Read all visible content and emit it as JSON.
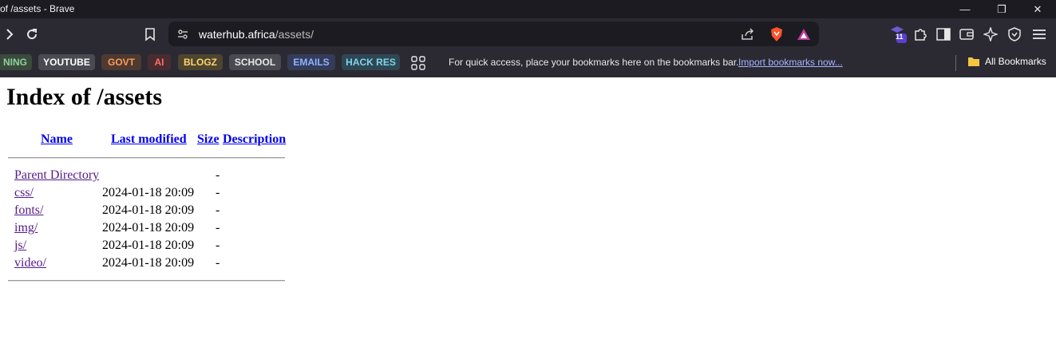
{
  "window": {
    "title": "of /assets - Brave",
    "controls": {
      "minimize": "—",
      "restore": "❐",
      "close": "✕"
    }
  },
  "toolbar": {
    "forward_icon": "chevron-right-icon",
    "reload_icon": "reload-icon",
    "bookmark_icon": "bookmark-icon",
    "url_host": "waterhub.africa",
    "url_path": "/assets/",
    "extension_badge": "11"
  },
  "bookmarks_bar": {
    "items": [
      {
        "label": "NING",
        "bg": "#3a4a3c",
        "fg": "#8fd19e"
      },
      {
        "label": "YOUTUBE",
        "bg": "#4a4a52",
        "fg": "#ffffff"
      },
      {
        "label": "GOVT",
        "bg": "#4d3a30",
        "fg": "#ff9b5c"
      },
      {
        "label": "AI",
        "bg": "#4a2c30",
        "fg": "#ff6b6b"
      },
      {
        "label": "BLOGZ",
        "bg": "#4d4530",
        "fg": "#ffd36b"
      },
      {
        "label": "SCHOOL",
        "bg": "#4a4a52",
        "fg": "#e8e8e8"
      },
      {
        "label": "EMAILS",
        "bg": "#343c5a",
        "fg": "#8fb2ff"
      },
      {
        "label": "HACK RES",
        "bg": "#2f4752",
        "fg": "#7fd3ee"
      }
    ],
    "hint": "For quick access, place your bookmarks here on the bookmarks bar.",
    "import_link": "Import bookmarks now...",
    "all_bookmarks": "All Bookmarks"
  },
  "page": {
    "heading": "Index of /assets",
    "columns": {
      "name": "Name",
      "last_modified": "Last modified",
      "size": "Size",
      "description": "Description"
    },
    "entries": [
      {
        "name": "Parent Directory",
        "modified": "",
        "size": "-"
      },
      {
        "name": "css/",
        "modified": "2024-01-18 20:09",
        "size": "-"
      },
      {
        "name": "fonts/",
        "modified": "2024-01-18 20:09",
        "size": "-"
      },
      {
        "name": "img/",
        "modified": "2024-01-18 20:09",
        "size": "-"
      },
      {
        "name": "js/",
        "modified": "2024-01-18 20:09",
        "size": "-"
      },
      {
        "name": "video/",
        "modified": "2024-01-18 20:09",
        "size": "-"
      }
    ]
  }
}
